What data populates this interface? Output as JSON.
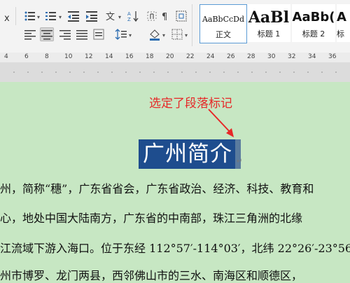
{
  "ribbon": {
    "styles": [
      {
        "sample": "AaBbCcDd",
        "name": "正文",
        "selected": true
      },
      {
        "sample": "AaBl",
        "name": "标题 1",
        "selected": false
      },
      {
        "sample": "AaBb(",
        "name": "标题 2",
        "selected": false
      },
      {
        "sample": "A",
        "name": "标",
        "selected": false
      }
    ]
  },
  "ruler": {
    "numbers": [
      "4",
      "6",
      "8",
      "10",
      "12",
      "14",
      "16",
      "18",
      "20",
      "22",
      "24",
      "26",
      "28",
      "30",
      "32",
      "34",
      "36"
    ]
  },
  "document": {
    "annotation": "选定了段落标记",
    "title": "广州简介",
    "lines": [
      "州，简称“穗”，广东省省会，广东省政治、经济、科技、教育和",
      "心，地处中国大陆南方，广东省的中南部，珠江三角洲的北缘",
      "江流域下游入海口。位于东经 112°57′-114°03′，北纬 22°26′-23°56",
      "州市博罗、龙门两县，西邻佛山市的三水、南海区和顺德区，"
    ]
  },
  "colors": {
    "selection": "#1e4d8e",
    "annotation": "#e62828",
    "page_bg": "#c7e7c3"
  }
}
